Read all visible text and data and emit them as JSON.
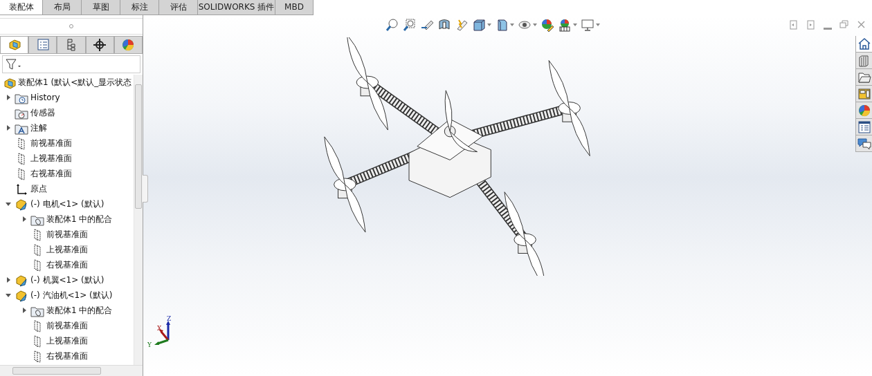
{
  "command_tabs": [
    {
      "label": "装配体",
      "selected": true
    },
    {
      "label": "布局",
      "selected": false
    },
    {
      "label": "草图",
      "selected": false
    },
    {
      "label": "标注",
      "selected": false
    },
    {
      "label": "评估",
      "selected": false
    },
    {
      "label": "SOLIDWORKS 插件",
      "selected": false
    },
    {
      "label": "MBD",
      "selected": false
    }
  ],
  "panel_tabs": [
    {
      "kind": "feature",
      "selected": true
    },
    {
      "kind": "property",
      "selected": false
    },
    {
      "kind": "config",
      "selected": false
    },
    {
      "kind": "dimxpert",
      "selected": false
    },
    {
      "kind": "display",
      "selected": false
    }
  ],
  "tree": {
    "label": "装配体1  (默认<默认_显示状态",
    "kind": "assembly",
    "children": [
      {
        "label": "History",
        "kind": "history",
        "expanded": false
      },
      {
        "label": "传感器",
        "kind": "sensor"
      },
      {
        "label": "注解",
        "kind": "annotation",
        "expanded": false
      },
      {
        "label": "前视基准面",
        "kind": "plane"
      },
      {
        "label": "上视基准面",
        "kind": "plane"
      },
      {
        "label": "右视基准面",
        "kind": "plane"
      },
      {
        "label": "原点",
        "kind": "origin"
      },
      {
        "label": "(-) 电机<1> (默认)",
        "kind": "part",
        "expanded": true,
        "children": [
          {
            "label": "装配体1 中的配合",
            "kind": "mates",
            "expanded": false
          },
          {
            "label": "前视基准面",
            "kind": "plane"
          },
          {
            "label": "上视基准面",
            "kind": "plane"
          },
          {
            "label": "右视基准面",
            "kind": "plane"
          }
        ]
      },
      {
        "label": "(-) 机翼<1> (默认)",
        "kind": "part",
        "expanded": false
      },
      {
        "label": "(-) 汽油机<1> (默认)",
        "kind": "part",
        "expanded": true,
        "children": [
          {
            "label": "装配体1 中的配合",
            "kind": "mates",
            "expanded": false
          },
          {
            "label": "前视基准面",
            "kind": "plane"
          },
          {
            "label": "上视基准面",
            "kind": "plane"
          },
          {
            "label": "右视基准面",
            "kind": "plane"
          }
        ]
      }
    ]
  },
  "task_pane_tabs": [
    {
      "selected": true
    },
    {
      "selected": false
    },
    {
      "selected": false
    },
    {
      "selected": false
    },
    {
      "selected": false
    },
    {
      "selected": false
    },
    {
      "selected": false
    }
  ],
  "triad": {
    "x": "X",
    "y": "Y",
    "z": "Z"
  }
}
